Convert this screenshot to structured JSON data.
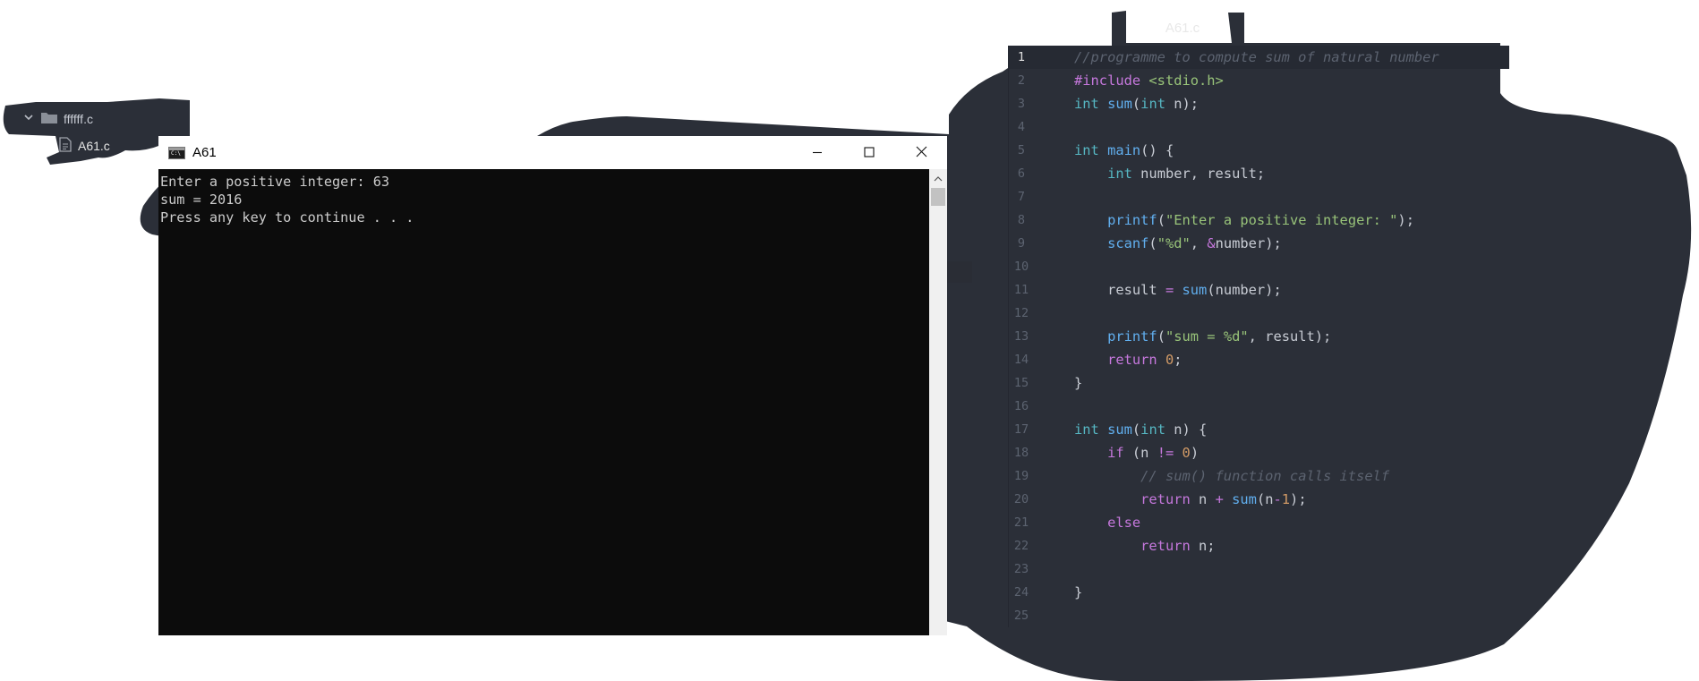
{
  "editor": {
    "tab_label": "A61.c",
    "lines": [
      {
        "n": "1",
        "tokens": [
          {
            "c": "cmt",
            "t": "//programme to compute sum of natural number"
          }
        ]
      },
      {
        "n": "2",
        "tokens": [
          {
            "c": "inc",
            "t": "#include "
          },
          {
            "c": "hdr",
            "t": "<stdio.h>"
          }
        ]
      },
      {
        "n": "3",
        "tokens": [
          {
            "c": "type",
            "t": "int "
          },
          {
            "c": "fn",
            "t": "sum"
          },
          {
            "c": "id",
            "t": "("
          },
          {
            "c": "type",
            "t": "int "
          },
          {
            "c": "id",
            "t": "n);"
          }
        ]
      },
      {
        "n": "4",
        "tokens": []
      },
      {
        "n": "5",
        "tokens": [
          {
            "c": "type",
            "t": "int "
          },
          {
            "c": "fn",
            "t": "main"
          },
          {
            "c": "id",
            "t": "() {"
          }
        ]
      },
      {
        "n": "6",
        "tokens": [
          {
            "c": "id",
            "t": "    "
          },
          {
            "c": "type",
            "t": "int "
          },
          {
            "c": "id",
            "t": "number, result;"
          }
        ]
      },
      {
        "n": "7",
        "tokens": []
      },
      {
        "n": "8",
        "tokens": [
          {
            "c": "id",
            "t": "    "
          },
          {
            "c": "fn",
            "t": "printf"
          },
          {
            "c": "id",
            "t": "("
          },
          {
            "c": "str",
            "t": "\"Enter a positive integer: \""
          },
          {
            "c": "id",
            "t": ");"
          }
        ]
      },
      {
        "n": "9",
        "tokens": [
          {
            "c": "id",
            "t": "    "
          },
          {
            "c": "fn",
            "t": "scanf"
          },
          {
            "c": "id",
            "t": "("
          },
          {
            "c": "str",
            "t": "\"%d\""
          },
          {
            "c": "id",
            "t": ", "
          },
          {
            "c": "op",
            "t": "&"
          },
          {
            "c": "id",
            "t": "number);"
          }
        ]
      },
      {
        "n": "10",
        "tokens": []
      },
      {
        "n": "11",
        "tokens": [
          {
            "c": "id",
            "t": "    result "
          },
          {
            "c": "op",
            "t": "="
          },
          {
            "c": "id",
            "t": " "
          },
          {
            "c": "fn",
            "t": "sum"
          },
          {
            "c": "id",
            "t": "(number);"
          }
        ]
      },
      {
        "n": "12",
        "tokens": []
      },
      {
        "n": "13",
        "tokens": [
          {
            "c": "id",
            "t": "    "
          },
          {
            "c": "fn",
            "t": "printf"
          },
          {
            "c": "id",
            "t": "("
          },
          {
            "c": "str",
            "t": "\"sum = %d\""
          },
          {
            "c": "id",
            "t": ", result);"
          }
        ]
      },
      {
        "n": "14",
        "tokens": [
          {
            "c": "id",
            "t": "    "
          },
          {
            "c": "kw",
            "t": "return "
          },
          {
            "c": "num",
            "t": "0"
          },
          {
            "c": "id",
            "t": ";"
          }
        ]
      },
      {
        "n": "15",
        "tokens": [
          {
            "c": "id",
            "t": "}"
          }
        ]
      },
      {
        "n": "16",
        "tokens": []
      },
      {
        "n": "17",
        "tokens": [
          {
            "c": "type",
            "t": "int "
          },
          {
            "c": "fn",
            "t": "sum"
          },
          {
            "c": "id",
            "t": "("
          },
          {
            "c": "type",
            "t": "int "
          },
          {
            "c": "id",
            "t": "n) {"
          }
        ]
      },
      {
        "n": "18",
        "tokens": [
          {
            "c": "id",
            "t": "    "
          },
          {
            "c": "kw",
            "t": "if "
          },
          {
            "c": "id",
            "t": "(n "
          },
          {
            "c": "op",
            "t": "!="
          },
          {
            "c": "id",
            "t": " "
          },
          {
            "c": "num",
            "t": "0"
          },
          {
            "c": "id",
            "t": ")"
          }
        ]
      },
      {
        "n": "19",
        "tokens": [
          {
            "c": "id",
            "t": "        "
          },
          {
            "c": "cmt",
            "t": "// sum() function calls itself"
          }
        ]
      },
      {
        "n": "20",
        "tokens": [
          {
            "c": "id",
            "t": "        "
          },
          {
            "c": "kw",
            "t": "return "
          },
          {
            "c": "id",
            "t": "n "
          },
          {
            "c": "op",
            "t": "+"
          },
          {
            "c": "id",
            "t": " "
          },
          {
            "c": "fn",
            "t": "sum"
          },
          {
            "c": "id",
            "t": "(n"
          },
          {
            "c": "op",
            "t": "-"
          },
          {
            "c": "num",
            "t": "1"
          },
          {
            "c": "id",
            "t": ");"
          }
        ]
      },
      {
        "n": "21",
        "tokens": [
          {
            "c": "id",
            "t": "    "
          },
          {
            "c": "kw",
            "t": "else"
          }
        ]
      },
      {
        "n": "22",
        "tokens": [
          {
            "c": "id",
            "t": "        "
          },
          {
            "c": "kw",
            "t": "return "
          },
          {
            "c": "id",
            "t": "n;"
          }
        ]
      },
      {
        "n": "23",
        "tokens": []
      },
      {
        "n": "24",
        "tokens": [
          {
            "c": "id",
            "t": "}"
          }
        ]
      },
      {
        "n": "25",
        "tokens": []
      }
    ]
  },
  "sidebar": {
    "folder_label": "ffffff.c",
    "file_label": "A61.c",
    "folder_icon": "folder-icon",
    "file_icon": "file-icon"
  },
  "console": {
    "title": "A61",
    "output_lines": [
      "Enter a positive integer: 63",
      "sum = 2016",
      "Press any key to continue . . ."
    ]
  },
  "colors": {
    "editor_bg": "#2b2f38",
    "console_bg": "#0c0c0c",
    "keyword": "#c678dd",
    "function": "#61afef",
    "string": "#98c379",
    "number": "#d19a66"
  }
}
